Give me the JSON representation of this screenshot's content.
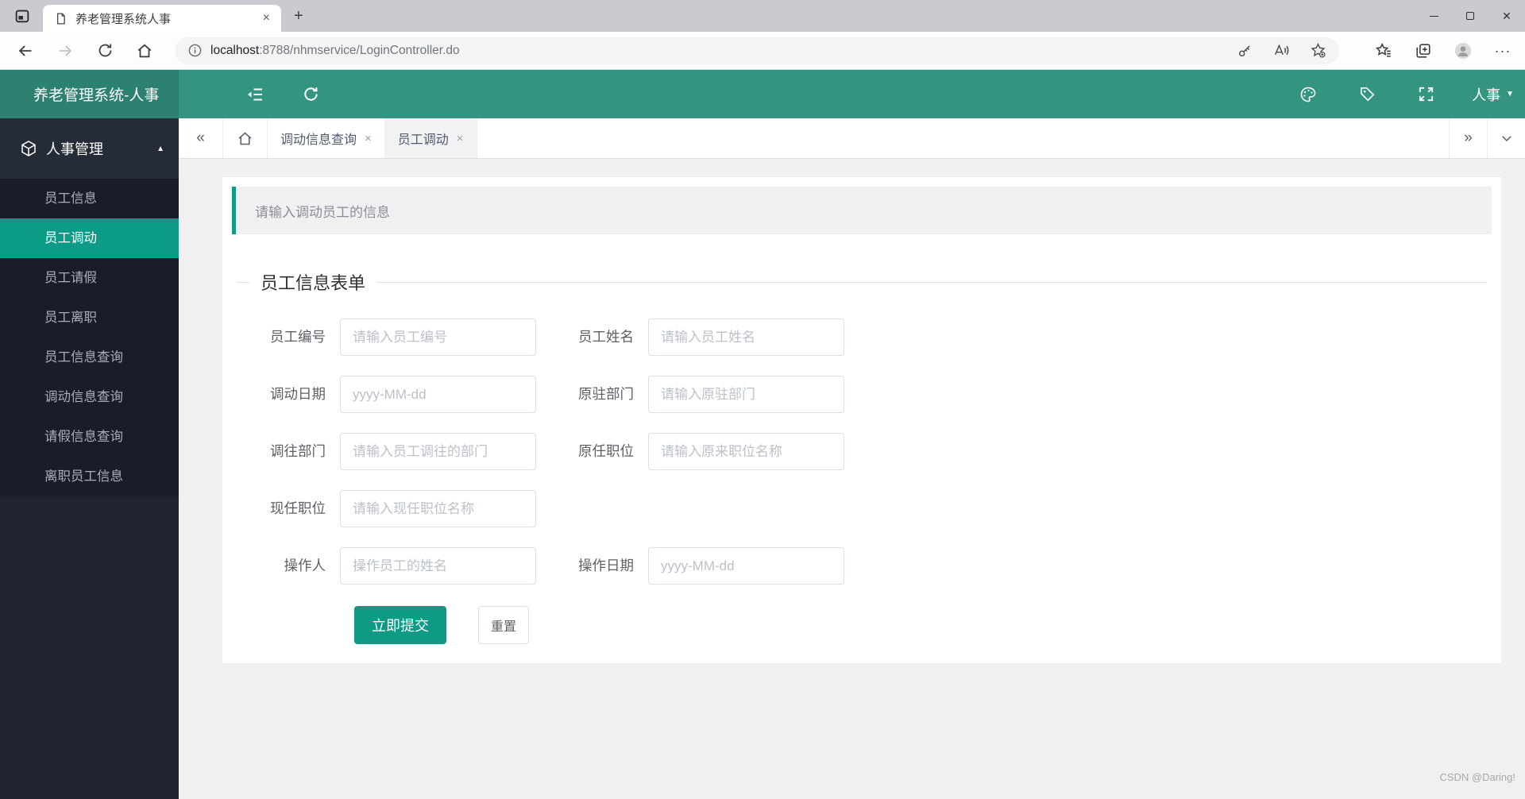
{
  "colors": {
    "teal": "#0c9b87",
    "header_green": "#33957f",
    "logo_green": "#2c8170",
    "sidebar_bg": "#20242f"
  },
  "browser": {
    "tab_title": "养老管理系统人事",
    "url_host": "localhost",
    "url_rest": ":8788/nhmservice/LoginController.do"
  },
  "glyphs": {
    "close_x": "×",
    "window_close": "✕",
    "plus": "+",
    "more": "···",
    "caret_up": "▲",
    "caret_down": "▼",
    "chevrons_left": "«",
    "chevrons_right": "»"
  },
  "header": {
    "title": "养老管理系统-人事",
    "user": "人事"
  },
  "sidebar": {
    "section": {
      "label": "人事管理"
    },
    "items": [
      {
        "label": "员工信息",
        "active": false
      },
      {
        "label": "员工调动",
        "active": true
      },
      {
        "label": "员工请假",
        "active": false
      },
      {
        "label": "员工离职",
        "active": false
      },
      {
        "label": "员工信息查询",
        "active": false
      },
      {
        "label": "调动信息查询",
        "active": false
      },
      {
        "label": "请假信息查询",
        "active": false
      },
      {
        "label": "离职员工信息",
        "active": false
      }
    ]
  },
  "tabbar": {
    "tabs": [
      {
        "label": "调动信息查询",
        "active": false
      },
      {
        "label": "员工调动",
        "active": true
      }
    ]
  },
  "main": {
    "alert_text": "请输入调动员工的信息",
    "form_title": "员工信息表单",
    "rows": [
      {
        "cells": [
          {
            "label": "员工编号",
            "placeholder": "请输入员工编号"
          },
          {
            "label": "员工姓名",
            "placeholder": "请输入员工姓名"
          }
        ]
      },
      {
        "cells": [
          {
            "label": "调动日期",
            "placeholder": "yyyy-MM-dd"
          },
          {
            "label": "原驻部门",
            "placeholder": "请输入原驻部门"
          }
        ]
      },
      {
        "cells": [
          {
            "label": "调往部门",
            "placeholder": "请输入员工调往的部门"
          },
          {
            "label": "原任职位",
            "placeholder": "请输入原来职位名称"
          }
        ]
      },
      {
        "cells": [
          {
            "label": "现任职位",
            "placeholder": "请输入现任职位名称"
          }
        ]
      },
      {
        "cells": [
          {
            "label": "操作人",
            "placeholder": "操作员工的姓名"
          },
          {
            "label": "操作日期",
            "placeholder": "yyyy-MM-dd"
          }
        ]
      }
    ],
    "submit_label": "立即提交",
    "reset_label": "重置"
  },
  "watermark": "CSDN @Daring!"
}
